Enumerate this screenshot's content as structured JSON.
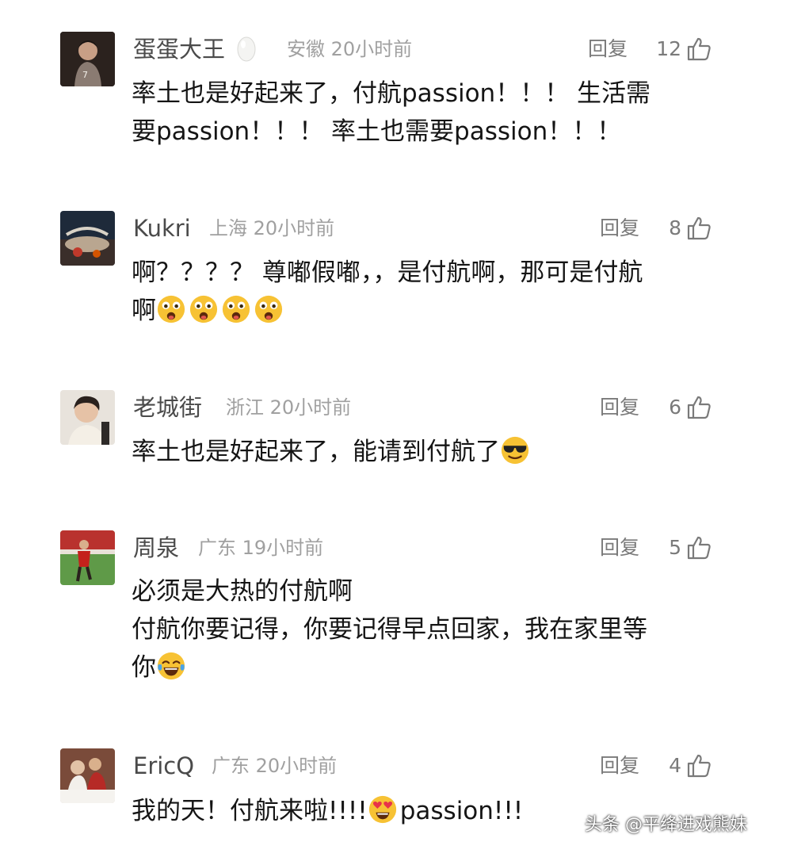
{
  "comments": [
    {
      "user": "蛋蛋大王",
      "user_badge": "egg-emoji",
      "location": "安徽",
      "time": "20小时前",
      "reply_label": "回复",
      "likes": "12",
      "lines": [
        "率土也是好起来了，付航passion！！！ 生活需",
        "要passion！！！ 率土也需要passion！！！"
      ]
    },
    {
      "user": "Kukri",
      "location": "上海",
      "time": "20小时前",
      "reply_label": "回复",
      "likes": "8",
      "lines": [
        "啊？？？？ 尊嘟假嘟，，是付航啊，那可是付航",
        "啊"
      ],
      "emojis": [
        "astonished-face-emoji",
        "astonished-face-emoji",
        "astonished-face-emoji",
        "astonished-face-emoji"
      ]
    },
    {
      "user": "老城街",
      "location": "浙江",
      "time": "20小时前",
      "reply_label": "回复",
      "likes": "6",
      "lines": [
        "率土也是好起来了，能请到付航了"
      ],
      "emojis": [
        "sunglasses-face-emoji"
      ]
    },
    {
      "user": "周泉",
      "location": "广东",
      "time": "19小时前",
      "reply_label": "回复",
      "likes": "5",
      "lines": [
        "必须是大热的付航啊",
        "付航你要记得，你要记得早点回家，我在家里等",
        "你"
      ],
      "emojis": [
        "tears-of-joy-emoji"
      ]
    },
    {
      "user": "EricQ",
      "location": "广东",
      "time": "20小时前",
      "reply_label": "回复",
      "likes": "4",
      "line_pre": "我的天！付航来啦!!!!",
      "line_post": "passion!!!",
      "emojis": [
        "heart-eyes-emoji"
      ]
    }
  ],
  "watermark": "头条 @平绛进戏熊妹",
  "colors": {
    "text": "#151515",
    "meta": "#a0a0a0",
    "action": "#7a7a7a",
    "emoji_yellow": "#f7c234"
  }
}
